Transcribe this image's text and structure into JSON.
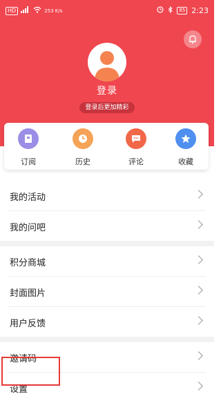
{
  "statusbar": {
    "network_chip": "HD",
    "speed": "253 K/s",
    "battery": "85",
    "time": "2:23"
  },
  "profile": {
    "login_title": "登录",
    "subtitle": "登录后更加精彩"
  },
  "quick_actions": [
    {
      "label": "订阅",
      "color": "#9b8ee6",
      "icon": "subscribe-icon"
    },
    {
      "label": "历史",
      "color": "#f5a356",
      "icon": "history-icon"
    },
    {
      "label": "评论",
      "color": "#f16848",
      "icon": "comment-icon"
    },
    {
      "label": "收藏",
      "color": "#4f8ff0",
      "icon": "star-icon"
    }
  ],
  "menu": {
    "group1": [
      "我的活动",
      "我的问吧"
    ],
    "group2": [
      "积分商城",
      "封面图片",
      "用户反馈"
    ],
    "group3": [
      "邀请码",
      "设置"
    ]
  },
  "colors": {
    "header_bg": "#f0464f",
    "highlight_border": "#e53935"
  }
}
